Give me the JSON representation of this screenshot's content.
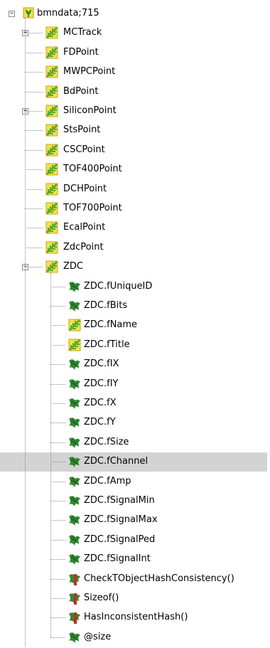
{
  "root": {
    "label": "bmndata;715",
    "icon": "tree-root-icon",
    "expander": "−"
  },
  "items": [
    {
      "label": "MCTrack",
      "icon": "branch-icon",
      "expander": "+"
    },
    {
      "label": "FDPoint",
      "icon": "branch-icon"
    },
    {
      "label": "MWPCPoint",
      "icon": "branch-icon"
    },
    {
      "label": "BdPoint",
      "icon": "branch-icon"
    },
    {
      "label": "SiliconPoint",
      "icon": "branch-icon",
      "expander": "+"
    },
    {
      "label": "StsPoint",
      "icon": "branch-icon"
    },
    {
      "label": "CSCPoint",
      "icon": "branch-icon"
    },
    {
      "label": "TOF400Point",
      "icon": "branch-icon"
    },
    {
      "label": "DCHPoint",
      "icon": "branch-icon"
    },
    {
      "label": "TOF700Point",
      "icon": "branch-icon"
    },
    {
      "label": "EcalPoint",
      "icon": "branch-icon"
    },
    {
      "label": "ZdcPoint",
      "icon": "branch-icon"
    },
    {
      "label": "ZDC",
      "icon": "branch-icon",
      "expander": "−"
    }
  ],
  "zdc_children": [
    {
      "label": "ZDC.fUniqueID",
      "icon": "leaf-icon"
    },
    {
      "label": "ZDC.fBits",
      "icon": "leaf-icon"
    },
    {
      "label": "ZDC.fName",
      "icon": "branch-icon"
    },
    {
      "label": "ZDC.fTitle",
      "icon": "branch-icon"
    },
    {
      "label": "ZDC.fIX",
      "icon": "leaf-icon"
    },
    {
      "label": "ZDC.fIY",
      "icon": "leaf-icon"
    },
    {
      "label": "ZDC.fX",
      "icon": "leaf-icon"
    },
    {
      "label": "ZDC.fY",
      "icon": "leaf-icon"
    },
    {
      "label": "ZDC.fSize",
      "icon": "leaf-icon"
    },
    {
      "label": "ZDC.fChannel",
      "icon": "leaf-icon",
      "selected": true
    },
    {
      "label": "ZDC.fAmp",
      "icon": "leaf-icon"
    },
    {
      "label": "ZDC.fSignalMin",
      "icon": "leaf-icon"
    },
    {
      "label": "ZDC.fSignalMax",
      "icon": "leaf-icon"
    },
    {
      "label": "ZDC.fSignalPed",
      "icon": "leaf-icon"
    },
    {
      "label": "ZDC.fSignalInt",
      "icon": "leaf-icon"
    },
    {
      "label": "CheckTObjectHashConsistency()",
      "icon": "method-leaf-icon"
    },
    {
      "label": "Sizeof()",
      "icon": "method-leaf-icon"
    },
    {
      "label": "HasInconsistentHash()",
      "icon": "method-leaf-icon"
    },
    {
      "label": "@size",
      "icon": "leaf-icon"
    }
  ],
  "colors": {
    "selection": "#d3d3d3",
    "branch_green": "#5aa832",
    "branch_yellow": "#f2e24a",
    "leaf_green": "#2f8a2f",
    "method_red": "#c8282a"
  }
}
